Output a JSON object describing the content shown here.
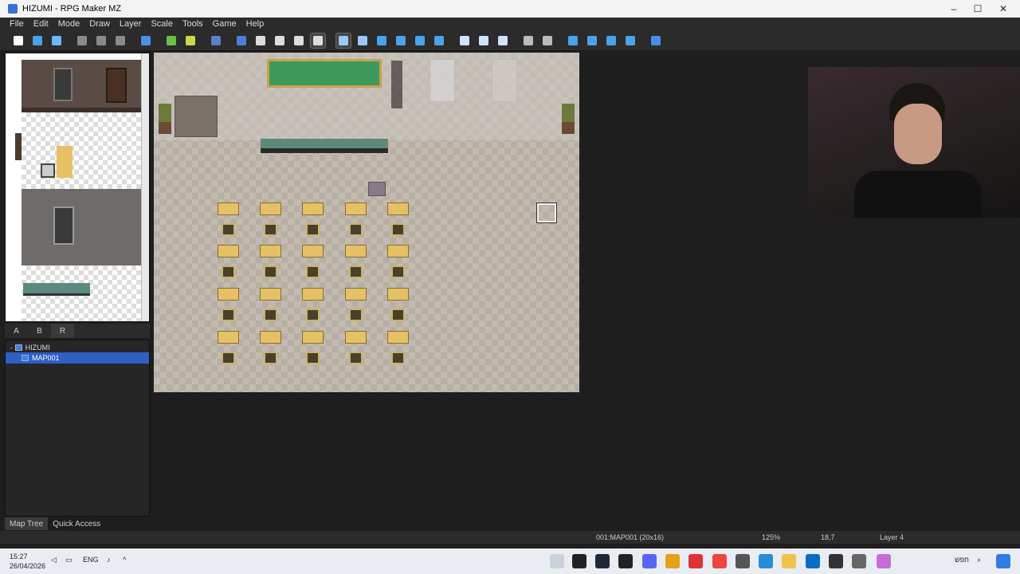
{
  "window": {
    "title": "HIZUMI - RPG Maker MZ",
    "controls": [
      "–",
      "☐",
      "✕"
    ]
  },
  "menu": [
    "File",
    "Edit",
    "Mode",
    "Draw",
    "Layer",
    "Scale",
    "Tools",
    "Game",
    "Help"
  ],
  "toolbar": {
    "buttons": [
      {
        "name": "new-project",
        "color": "#ffffff"
      },
      {
        "name": "open-project",
        "color": "#4aa3e8"
      },
      {
        "name": "save-project",
        "color": "#6db7ff"
      },
      {
        "name": "cut",
        "color": "#8a8a8a"
      },
      {
        "name": "copy",
        "color": "#8a8a8a"
      },
      {
        "name": "paste",
        "color": "#8a8a8a"
      },
      {
        "name": "undo",
        "color": "#4a90e2"
      },
      {
        "name": "map-mode",
        "color": "#6cc04a"
      },
      {
        "name": "event-mode",
        "color": "#c9d94a"
      },
      {
        "name": "region-mode",
        "color": "#5c7fc9"
      },
      {
        "name": "layer-1",
        "color": "#4a7fd8"
      },
      {
        "name": "layer-2",
        "color": "#dddddd"
      },
      {
        "name": "layer-3",
        "color": "#dddddd"
      },
      {
        "name": "layer-4",
        "color": "#dddddd"
      },
      {
        "name": "current-layer",
        "color": "#dddddd"
      },
      {
        "name": "pencil",
        "color": "#9ac7ff"
      },
      {
        "name": "eraser",
        "color": "#9ac7ff"
      },
      {
        "name": "rectangle",
        "color": "#4aa3e8"
      },
      {
        "name": "ellipse",
        "color": "#4aa3e8"
      },
      {
        "name": "fill",
        "color": "#4aa3e8"
      },
      {
        "name": "shadow-pen",
        "color": "#4aa3e8"
      },
      {
        "name": "zoom-in",
        "color": "#cfe3ff"
      },
      {
        "name": "zoom-out",
        "color": "#cfe3ff"
      },
      {
        "name": "actual-size",
        "color": "#cfe3ff"
      },
      {
        "name": "database",
        "color": "#bbbbbb"
      },
      {
        "name": "plugin-manager",
        "color": "#bbbbbb"
      },
      {
        "name": "sound-test",
        "color": "#4aa3e8"
      },
      {
        "name": "event-searcher",
        "color": "#4aa3e8"
      },
      {
        "name": "resource-manager",
        "color": "#4aa3e8"
      },
      {
        "name": "character-generator",
        "color": "#4aa3e8"
      },
      {
        "name": "playtest",
        "color": "#4a90e2"
      }
    ]
  },
  "tileset_tabs": [
    "A",
    "B",
    "R"
  ],
  "map_tree": {
    "items": [
      {
        "label": "HIZUMI",
        "selected": false
      },
      {
        "label": "MAP001",
        "selected": true
      }
    ]
  },
  "bottom_tabs": [
    "Map Tree",
    "Quick Access"
  ],
  "status": {
    "map": "001:MAP001 (20x16)",
    "zoom": "125%",
    "coords": "18,7",
    "layer": "Layer 4"
  },
  "taskbar": {
    "time": "15:27",
    "date": "26/04/2026",
    "lang": "ENG",
    "language_indicator": "חפש"
  },
  "colors": {
    "selection": "#2f5fc4",
    "floor": "#b7aea4",
    "chalkboard": "#3e9a5a",
    "desk": "#e6c064"
  }
}
